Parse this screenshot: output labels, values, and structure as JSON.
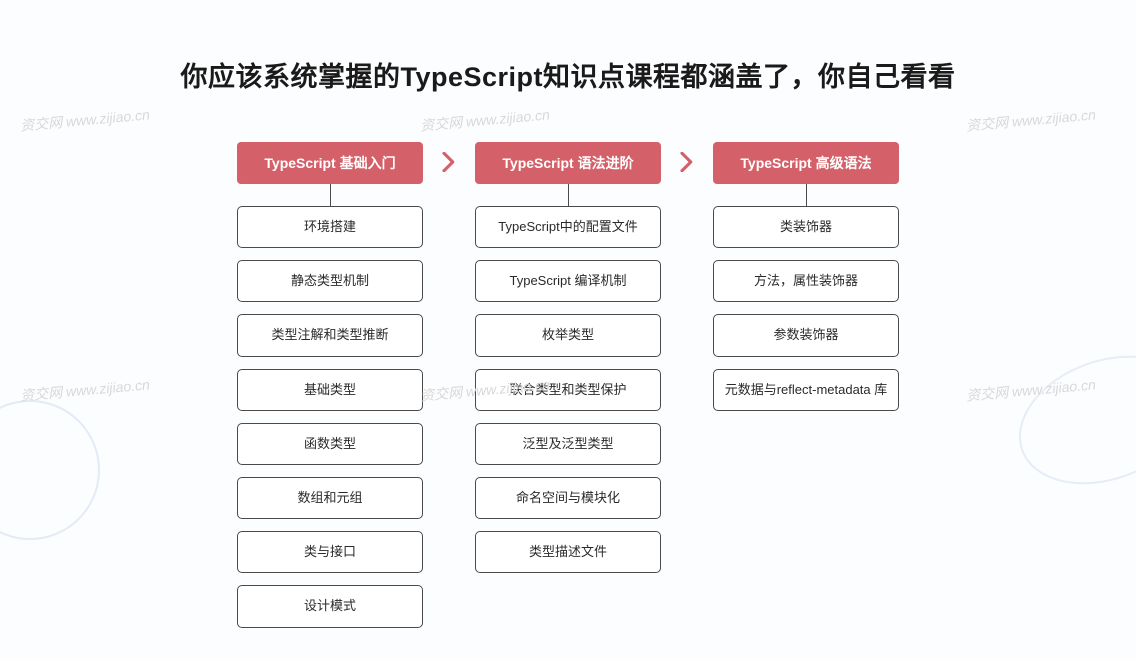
{
  "title": "你应该系统掌握的TypeScript知识点课程都涵盖了，你自己看看",
  "watermark_text": "资交网 www.zijiao.cn",
  "columns": [
    {
      "header": "TypeScript 基础入门",
      "topics": [
        "环境搭建",
        "静态类型机制",
        "类型注解和类型推断",
        "基础类型",
        "函数类型",
        "数组和元组",
        "类与接口",
        "设计模式"
      ]
    },
    {
      "header": "TypeScript 语法进阶",
      "topics": [
        "TypeScript中的配置文件",
        "TypeScript 编译机制",
        "枚举类型",
        "联合类型和类型保护",
        "泛型及泛型类型",
        "命名空间与模块化",
        "类型描述文件"
      ]
    },
    {
      "header": "TypeScript 高级语法",
      "topics": [
        "类装饰器",
        "方法，属性装饰器",
        "参数装饰器",
        "元数据与reflect-metadata 库"
      ]
    }
  ]
}
